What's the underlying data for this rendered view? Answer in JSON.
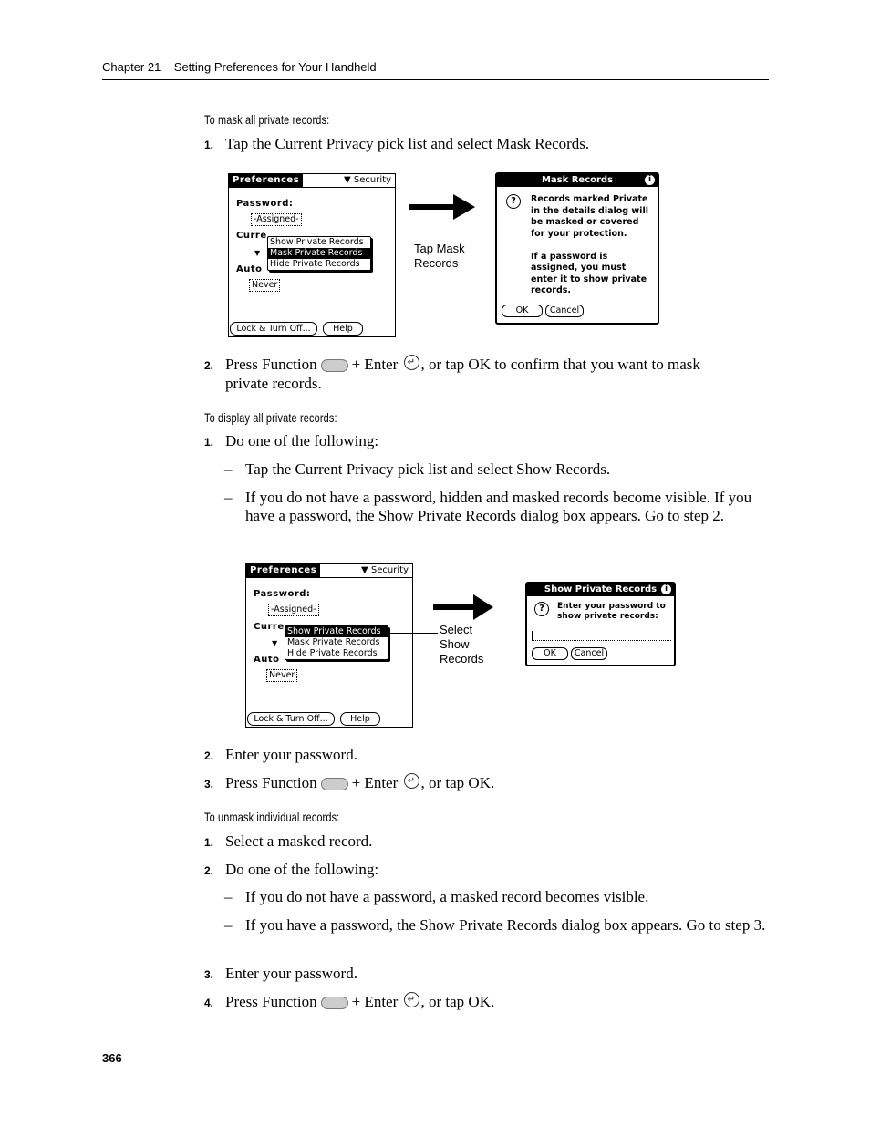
{
  "header": {
    "chapter": "Chapter 21",
    "title": "Setting Preferences for Your Handheld"
  },
  "sections": [
    {
      "heading": "To mask all private records:",
      "steps": [
        {
          "num": "1.",
          "text": "Tap the Current Privacy pick list and select Mask Records."
        },
        {
          "num": "2.",
          "text_before": "Press Function",
          "text_mid": "+ Enter",
          "text_after": ", or tap OK to confirm that you want to mask",
          "text_line2": "private records."
        }
      ]
    },
    {
      "heading": "To display all private records:",
      "steps": [
        {
          "num": "1.",
          "text": "Do one of the following:"
        },
        {
          "num": "2.",
          "text": "Enter your password."
        },
        {
          "num": "3.",
          "text_before": "Press Function",
          "text_mid": "+ Enter",
          "text_after": ", or tap OK."
        }
      ],
      "bullets": [
        {
          "dash": "–",
          "text": "Tap the Current Privacy pick list and select Show Records."
        },
        {
          "dash": "–",
          "text": "If you do not have a password, hidden and masked records become visible. If you have a password, the Show Private Records dialog box appears. Go to step 2."
        }
      ]
    },
    {
      "heading": "To unmask individual records:",
      "steps": [
        {
          "num": "1.",
          "text": "Select a masked record."
        },
        {
          "num": "2.",
          "text": "Do one of the following:"
        },
        {
          "num": "3.",
          "text": "Enter your password."
        },
        {
          "num": "4.",
          "text_before": "Press Function",
          "text_mid": "+ Enter",
          "text_after": ", or tap OK."
        }
      ],
      "bullets": [
        {
          "dash": "–",
          "text": "If you do not have a password, a masked record becomes visible."
        },
        {
          "dash": "–",
          "text": "If you have a password, the Show Private Records dialog box appears. Go to step 3."
        }
      ]
    }
  ],
  "prefs_screen": {
    "tab": "Preferences",
    "category": "Security",
    "password_label": "Password:",
    "password_value": "-Assigned-",
    "current_label": "Curre",
    "auto_label": "Auto",
    "auto_value": "Never",
    "menu": [
      "Show Private Records",
      "Mask Private Records",
      "Hide Private Records"
    ],
    "lock_button": "Lock & Turn Off...",
    "help_button": "Help"
  },
  "mask_dialog": {
    "title": "Mask Records",
    "info_icon": "i",
    "question_icon": "?",
    "message": [
      "Records marked Private",
      "in the details dialog will",
      "be masked or covered",
      "for your protection.",
      "",
      "If a password is",
      "assigned, you must",
      "enter it to show private",
      "records."
    ],
    "ok": "OK",
    "cancel": "Cancel"
  },
  "show_dialog": {
    "title": "Show Private Records",
    "info_icon": "i",
    "question_icon": "?",
    "message": [
      "Enter your password to",
      "show private records:"
    ],
    "ok": "OK",
    "cancel": "Cancel"
  },
  "callouts": {
    "mask": [
      "Tap Mask",
      "Records"
    ],
    "show": [
      "Select",
      "Show",
      "Records"
    ]
  },
  "icons": {
    "enter": "↵"
  },
  "page_number": "366"
}
